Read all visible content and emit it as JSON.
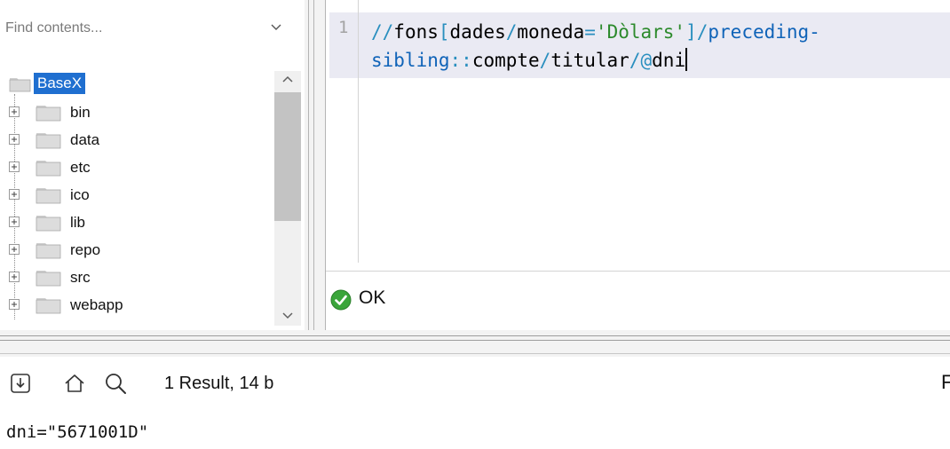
{
  "sidebar": {
    "search_placeholder": "Find contents...",
    "root_label": "BaseX",
    "items": [
      {
        "label": "bin"
      },
      {
        "label": "data"
      },
      {
        "label": "etc"
      },
      {
        "label": "ico"
      },
      {
        "label": "lib"
      },
      {
        "label": "repo"
      },
      {
        "label": "src"
      },
      {
        "label": "webapp"
      }
    ]
  },
  "editor": {
    "line_number": "1",
    "query": "//fons[dades/moneda='Dòlars']/preceding-sibling::compte/titular/@dni",
    "tokens_line1": [
      "//",
      "fons",
      "[",
      "dades",
      "/",
      "moneda",
      "=",
      "'Dòlars'",
      "]",
      "/",
      "preceding-"
    ],
    "tokens_line2": [
      "sibling",
      "::",
      "compte",
      "/",
      "titular",
      "/",
      "@",
      "dni"
    ],
    "status_text": "OK",
    "colors": {
      "operator": "#2a8fbf",
      "string": "#2c8a2c",
      "axis": "#0f63b8",
      "highlight": "#eaeaf3"
    }
  },
  "results": {
    "count_label": "1 Result, 14 b",
    "right_edge_char": "F",
    "value": "dni=\"5671001D\""
  },
  "icons": {
    "toolbar": [
      "save-result-icon",
      "home-icon",
      "search-icon"
    ]
  }
}
